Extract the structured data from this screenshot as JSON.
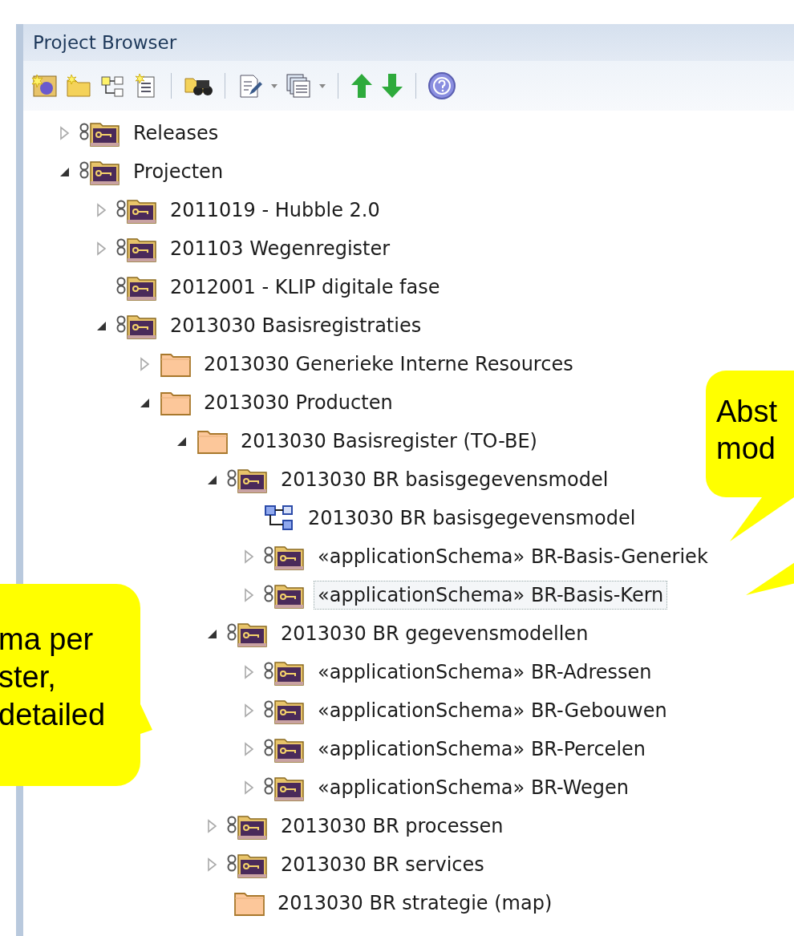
{
  "panel": {
    "title": "Project Browser"
  },
  "tree": [
    {
      "label": "Releases",
      "kind": "package",
      "expanded": false,
      "selected": false
    },
    {
      "label": "Projecten",
      "kind": "package",
      "expanded": true,
      "selected": false,
      "children": [
        {
          "label": "2011019 - Hubble 2.0",
          "kind": "package",
          "expanded": false,
          "selected": false
        },
        {
          "label": "201103 Wegenregister",
          "kind": "package",
          "expanded": false,
          "selected": false
        },
        {
          "label": "2012001 - KLIP digitale fase",
          "kind": "package",
          "selected": false
        },
        {
          "label": "2013030 Basisregistraties",
          "kind": "package",
          "expanded": true,
          "selected": false,
          "children": [
            {
              "label": "2013030 Generieke Interne Resources",
              "kind": "folder",
              "expanded": false,
              "selected": false
            },
            {
              "label": "2013030 Producten",
              "kind": "folder",
              "expanded": true,
              "selected": false,
              "children": [
                {
                  "label": "2013030 Basisregister (TO-BE)",
                  "kind": "folder",
                  "expanded": true,
                  "selected": false,
                  "children": [
                    {
                      "label": "2013030 BR basisgegevensmodel",
                      "kind": "package",
                      "expanded": true,
                      "selected": false,
                      "children": [
                        {
                          "label": "2013030 BR basisgegevensmodel",
                          "kind": "diagram",
                          "selected": false
                        },
                        {
                          "label": "«applicationSchema» BR-Basis-Generiek",
                          "kind": "package",
                          "expanded": false,
                          "selected": false
                        },
                        {
                          "label": "«applicationSchema» BR-Basis-Kern",
                          "kind": "package",
                          "expanded": false,
                          "selected": true
                        }
                      ]
                    },
                    {
                      "label": "2013030 BR gegevensmodellen",
                      "kind": "package",
                      "expanded": true,
                      "selected": false,
                      "children": [
                        {
                          "label": "«applicationSchema» BR-Adressen",
                          "kind": "package",
                          "expanded": false,
                          "selected": false
                        },
                        {
                          "label": "«applicationSchema» BR-Gebouwen",
                          "kind": "package",
                          "expanded": false,
                          "selected": false
                        },
                        {
                          "label": "«applicationSchema» BR-Percelen",
                          "kind": "package",
                          "expanded": false,
                          "selected": false
                        },
                        {
                          "label": "«applicationSchema» BR-Wegen",
                          "kind": "package",
                          "expanded": false,
                          "selected": false
                        }
                      ]
                    },
                    {
                      "label": "2013030 BR processen",
                      "kind": "package",
                      "expanded": false,
                      "selected": false
                    },
                    {
                      "label": "2013030 BR services",
                      "kind": "package",
                      "expanded": false,
                      "selected": false
                    },
                    {
                      "label": "2013030 BR strategie (map)",
                      "kind": "folder",
                      "selected": false
                    }
                  ]
                }
              ]
            }
          ]
        }
      ]
    }
  ],
  "callouts": [
    {
      "text": "Abst\nmod",
      "kind": "right"
    },
    {
      "text": "ma per\nster,\ndetailed",
      "kind": "left"
    }
  ]
}
